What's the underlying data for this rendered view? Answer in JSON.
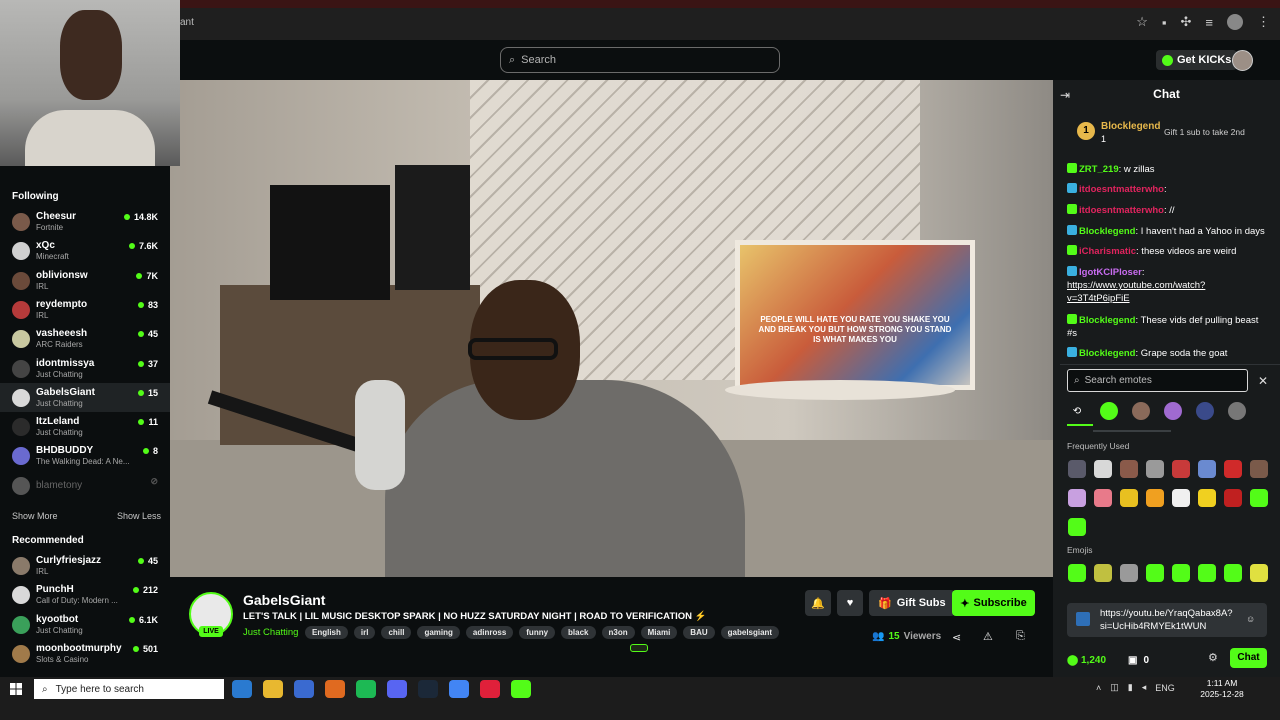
{
  "browser": {
    "tab_title": "ant",
    "icons": [
      "star-icon",
      "extensions-icon",
      "puzzle-icon",
      "menu-icon",
      "profile-icon",
      "kebab-icon"
    ]
  },
  "topnav": {
    "search_placeholder": "Search",
    "get_kicks_label": "Get KICKs"
  },
  "sidebar": {
    "following_heading": "Following",
    "following": [
      {
        "name": "Cheesur",
        "category": "Fortnite",
        "viewers": "14.8K",
        "color": "#7a5a4a"
      },
      {
        "name": "xQc",
        "category": "Minecraft",
        "viewers": "7.6K",
        "color": "#d0d0d0"
      },
      {
        "name": "oblivionsw",
        "category": "IRL",
        "viewers": "7K",
        "color": "#6b4a3a"
      },
      {
        "name": "reydempto",
        "category": "IRL",
        "viewers": "83",
        "color": "#b53a3a"
      },
      {
        "name": "vasheeesh",
        "category": "ARC Raiders",
        "viewers": "45",
        "color": "#c8c8a0"
      },
      {
        "name": "idontmissya",
        "category": "Just Chatting",
        "viewers": "37",
        "color": "#444"
      },
      {
        "name": "GabelsGiant",
        "category": "Just Chatting",
        "viewers": "15",
        "color": "#d9d9d9"
      },
      {
        "name": "ItzLeland",
        "category": "Just Chatting",
        "viewers": "11",
        "color": "#2b2b2b"
      },
      {
        "name": "BHDBUDDY",
        "category": "The Walking Dead: A Ne...",
        "viewers": "8",
        "color": "#6a6ad0"
      },
      {
        "name": "blametony",
        "category": "",
        "viewers": "",
        "color": "#555"
      }
    ],
    "show_more": "Show More",
    "show_less": "Show Less",
    "recommended_heading": "Recommended",
    "recommended": [
      {
        "name": "Curlyfriesjazz",
        "category": "IRL",
        "viewers": "45",
        "color": "#8a7a6a"
      },
      {
        "name": "PunchH",
        "category": "Call of Duty: Modern ...",
        "viewers": "212",
        "color": "#d9d9d9"
      },
      {
        "name": "kyootbot",
        "category": "Just Chatting",
        "viewers": "6.1K",
        "color": "#3aa05a"
      },
      {
        "name": "moonbootmurphy",
        "category": "Slots & Casino",
        "viewers": "501",
        "color": "#a07a4a"
      }
    ]
  },
  "video": {
    "sign_text": "PEOPLE WILL HATE YOU RATE YOU SHAKE YOU AND BREAK YOU BUT HOW STRONG YOU STAND IS WHAT MAKES YOU"
  },
  "stream": {
    "streamer": "GabelsGiant",
    "live_label": "LIVE",
    "title": "LET'S TALK | LIL MUSIC DESKTOP SPARK | NO HUZZ SATURDAY NIGHT | ROAD TO VERIFICATION ⚡",
    "category": "Just Chatting",
    "tags": [
      "English",
      "irl",
      "chill",
      "gaming",
      "adinross",
      "funny",
      "black",
      "n3on",
      "Miami",
      "BAU",
      "gabelsgiant"
    ],
    "gift_subs_label": "Gift Subs",
    "subscribe_label": "Subscribe",
    "viewer_count": "15",
    "viewers_label": "Viewers"
  },
  "chat": {
    "header": "Chat",
    "pinned": {
      "rank": "1",
      "name": "Blocklegend",
      "count": "1",
      "gift_text": "Gift 1 sub to take 2nd"
    },
    "messages": [
      {
        "user": "ZRT_219",
        "text": " w zillas",
        "color": "#53fc18"
      },
      {
        "user": "itdoesntmatterwho",
        "text": "",
        "color": "#e0245e"
      },
      {
        "user": "itdoesntmatterwho",
        "text": " //",
        "color": "#e0245e"
      },
      {
        "user": "Blocklegend",
        "text": " I haven't had a Yahoo in days",
        "color": "#53fc18"
      },
      {
        "user": "iCharismatic",
        "text": " these videos are weird",
        "color": "#e0245e"
      },
      {
        "user": "IgotKCIPloser",
        "text": "",
        "color": "#c86cf0"
      },
      {
        "user": "Blocklegend",
        "text": " These vids def pulling beast #s",
        "color": "#53fc18"
      },
      {
        "user": "Blocklegend",
        "text": " Grape soda the goat",
        "color": "#53fc18"
      }
    ],
    "link_line": "https://www.youtube.com/watch?v=3T4tP6ipFiE",
    "emote_search_placeholder": "Search emotes",
    "frequently_used": "Frequently Used",
    "emojis_label": "Emojis",
    "preview_text": "https://youtu.be/YraqQabax8A?si=UcHib4RMYEk1tWUN",
    "kicks_count": "1,240",
    "bag_count": "0",
    "chat_button": "Chat"
  },
  "taskbar": {
    "search_placeholder": "Type here to search",
    "lang": "ENG",
    "time": "1:11 AM",
    "date": "2025-12-28"
  },
  "colors": {
    "accent": "#53fc18",
    "bg": "#0b0e0f",
    "panel": "#181b1c",
    "chip": "#2f3336"
  }
}
